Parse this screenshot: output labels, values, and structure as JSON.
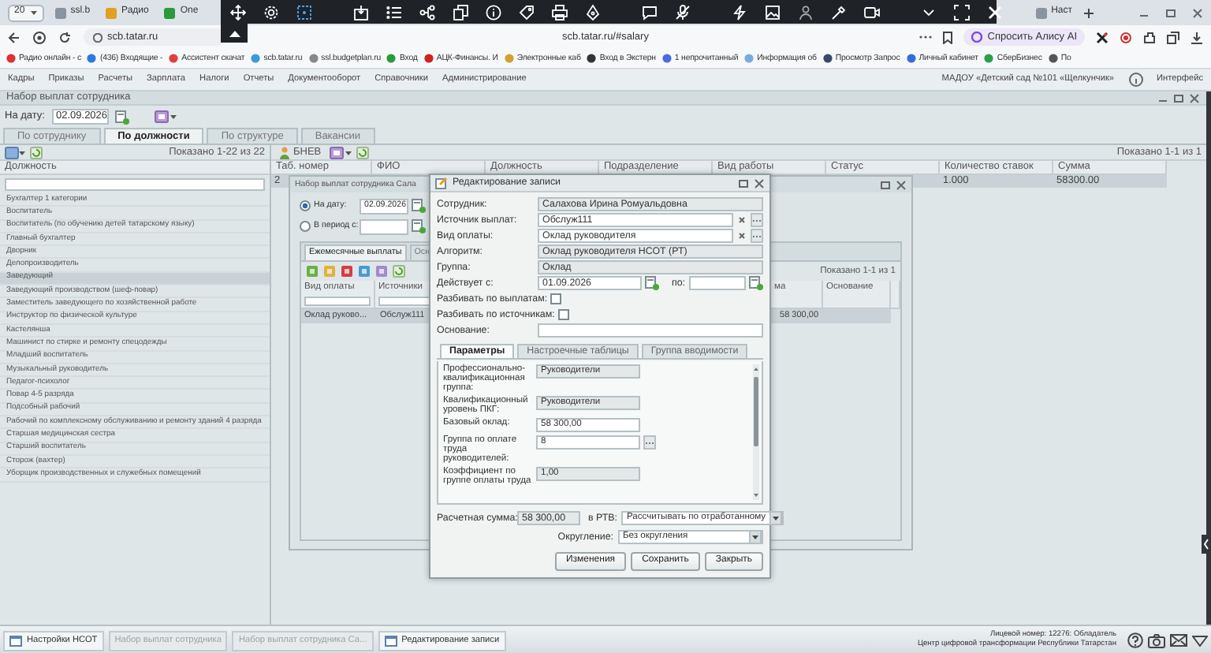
{
  "browser": {
    "tab_count": "20",
    "tabs": [
      "ssl.b",
      "Радио",
      "One"
    ],
    "right_tab": "Наст",
    "site": "scb.tatar.ru",
    "url": "scb.tatar.ru/#salary",
    "assistant": "Спросить Алису AI",
    "bookmarks": [
      "Радио онлайн - с",
      "(436) Входящие -",
      "Ассистент скачат",
      "scb.tatar.ru",
      "ssl.budgetplan.ru",
      "Вход",
      "АЦК-Финансы. И",
      "Электронные каб",
      "Вход в Экстерн",
      "1 непрочитанный",
      "Информация об",
      "Просмотр Запрос",
      "Личный кабинет",
      "СберБизнес",
      "По"
    ]
  },
  "menu": {
    "items": [
      "Кадры",
      "Приказы",
      "Расчеты",
      "Зарплата",
      "Налоги",
      "Отчеты",
      "Документооборот",
      "Справочники",
      "Администрирование"
    ],
    "organization": "МАДОУ «Детский сад №101 «Щелкунчик»",
    "interface": "Интерфейс"
  },
  "main_window": {
    "title": "Набор выплат сотрудника",
    "date_label": "На дату:",
    "date": "02.09.2026",
    "tabs": [
      {
        "label": "По сотруднику",
        "selected": false
      },
      {
        "label": "По должности",
        "selected": true
      },
      {
        "label": "По структуре",
        "selected": false
      },
      {
        "label": "Вакансии",
        "selected": false
      }
    ],
    "positions": {
      "shown": "Показано 1-22 из 22",
      "column": "Должность",
      "items": [
        {
          "label": "Бухгалтер 1 категории",
          "selected": false
        },
        {
          "label": "Воспитатель",
          "selected": false
        },
        {
          "label": "Воспитатель (по обучению детей татарскому языку)",
          "selected": false
        },
        {
          "label": "Главный бухгалтер",
          "selected": false
        },
        {
          "label": "Дворник",
          "selected": false
        },
        {
          "label": "Делопроизводитель",
          "selected": false
        },
        {
          "label": "Заведующий",
          "selected": true
        },
        {
          "label": "Заведующий производством (шеф-повар)",
          "selected": false
        },
        {
          "label": "Заместитель заведующего по хозяйственной работе",
          "selected": false
        },
        {
          "label": "Инструктор по физической культуре",
          "selected": false
        },
        {
          "label": "Кастелянша",
          "selected": false
        },
        {
          "label": "Машинист по стирке и ремонту спецодежды",
          "selected": false
        },
        {
          "label": "Младший воспитатель",
          "selected": false
        },
        {
          "label": "Музыкальный руководитель",
          "selected": false
        },
        {
          "label": "Педагог-психолог",
          "selected": false
        },
        {
          "label": "Повар 4-5 разряда",
          "selected": false
        },
        {
          "label": "Подсобный рабочий",
          "selected": false
        },
        {
          "label": "Рабочий по комплексному обслуживанию и ремонту зданий 4 разряда",
          "selected": false
        },
        {
          "label": "Старшая медицинская сестра",
          "selected": false
        },
        {
          "label": "Старший воспитатель",
          "selected": false
        },
        {
          "label": "Сторож (вахтер)",
          "selected": false
        },
        {
          "label": "Уборщик производственных и служебных помещений",
          "selected": false
        }
      ]
    },
    "employees": {
      "button": "БНЕВ",
      "shown": "Показано 1-1 из 1",
      "columns": [
        "Таб. номер",
        "ФИО",
        "Должность",
        "Подразделение",
        "Вид работы",
        "Статус",
        "Количество ставок",
        "Сумма"
      ],
      "rows": [
        {
          "tab_number": "2",
          "rate_count": "1.000",
          "sum": "58300.00",
          "selected": true
        }
      ]
    }
  },
  "payments_window": {
    "title": "Набор выплат сотрудника Сала",
    "radios": [
      {
        "label": "На дату:",
        "selected": true,
        "date": "02.09.2026"
      },
      {
        "label": "В период с:",
        "selected": false
      }
    ],
    "tabs": [
      {
        "label": "Ежемесячные выплаты",
        "selected": true
      },
      {
        "label": "Осн",
        "selected": false
      }
    ],
    "shown": "Показано 1-1 из 1",
    "columns": [
      "Вид оплаты",
      "Источники",
      "ма",
      "Основание"
    ],
    "rows": [
      {
        "pay_type": "Оклад руково...",
        "source": "Обслуж111",
        "sum": "58 300,00",
        "selected": true
      }
    ]
  },
  "dialog": {
    "title": "Редактирование записи",
    "fields": [
      {
        "kind": "text",
        "label": "Сотрудник:",
        "value": "Салахова Ирина Ромуальдовна",
        "disabled": true
      },
      {
        "kind": "lookup",
        "label": "Источник выплат:",
        "value": "Обслуж111",
        "disabled": false
      },
      {
        "kind": "lookup",
        "label": "Вид оплаты:",
        "value": "Оклад руководителя",
        "disabled": false
      },
      {
        "kind": "text",
        "label": "Алгоритм:",
        "value": "Оклад руководителя НСОТ (РТ)",
        "disabled": true
      },
      {
        "kind": "text",
        "label": "Группа:",
        "value": "Оклад",
        "disabled": true
      },
      {
        "kind": "period",
        "label": "Действует с:",
        "value": "01.09.2026",
        "to_label": "по:"
      },
      {
        "kind": "check",
        "label": "Разбивать по выплатам:",
        "checked": false
      },
      {
        "kind": "check",
        "label": "Разбивать по источникам:",
        "checked": false
      },
      {
        "kind": "text",
        "label": "Основание:",
        "disabled": false
      }
    ],
    "tabs": [
      {
        "label": "Параметры",
        "selected": true
      },
      {
        "label": "Настроечные таблицы",
        "selected": false
      },
      {
        "label": "Группа вводимости",
        "selected": false
      }
    ],
    "params": [
      {
        "kind": "text",
        "label": "Профессионально-квалификационная группа:",
        "value": "Руководители",
        "disabled": true
      },
      {
        "kind": "text",
        "label": "Квалификационный уровень ПКГ:",
        "value": "Руководители",
        "disabled": true
      },
      {
        "kind": "text",
        "label": "Базовый оклад:",
        "value": "58 300,00",
        "disabled": false
      },
      {
        "kind": "lookup",
        "label": "Группа по оплате труда руководителей:",
        "value": "8",
        "disabled": false
      },
      {
        "kind": "text",
        "label": "Коэффициент по группе оплаты труда",
        "value": "1,00",
        "disabled": true
      }
    ],
    "calc_label": "Расчетная сумма:",
    "calc_value": "58 300,00",
    "rtv_label": "в РТВ:",
    "rtv_value": "Рассчитывать по отработанному",
    "rounding_label": "Округление:",
    "rounding_value": "Без округления",
    "buttons": [
      "Изменения",
      "Сохранить",
      "Закрыть"
    ]
  },
  "taskbar": {
    "items": [
      {
        "label": "Настройки НСОТ",
        "dimmed": false
      },
      {
        "label": "Набор выплат сотрудника",
        "dimmed": true
      },
      {
        "label": "Набор выплат сотрудника Са...",
        "dimmed": true
      },
      {
        "label": "Редактирование записи",
        "dimmed": false
      }
    ],
    "license": "Лицевой номер: 12276: Обладатель",
    "org": "Центр цифровой трансформации Республики Татарстан"
  }
}
